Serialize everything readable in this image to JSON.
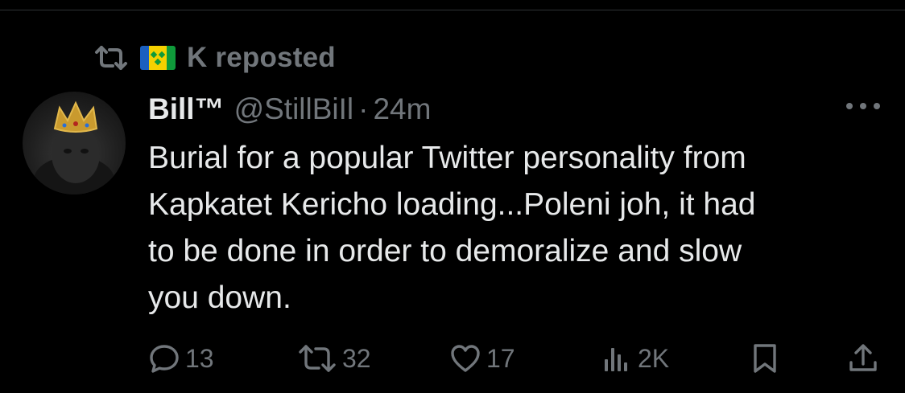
{
  "repost": {
    "text": "K reposted",
    "flag": "saint-vincent-and-the-grenadines-flag"
  },
  "tweet": {
    "author_name": "Bill™",
    "handle": "@StillBiIl",
    "separator": "·",
    "time": "24m",
    "text": "Burial for a popular Twitter personality from\nKapkatet Kericho loading...Poleni joh, it had\nto be done in order to demoralize and slow\nyou down."
  },
  "actions": {
    "replies": "13",
    "reposts": "32",
    "likes": "17",
    "views": "2K"
  },
  "icons": {
    "repost": "repost-icon",
    "more": "more-icon",
    "reply": "reply-icon",
    "like": "heart-icon",
    "views": "views-icon",
    "bookmark": "bookmark-icon",
    "share": "share-icon"
  },
  "colors": {
    "background": "#000000",
    "text_primary": "#e7e9ea",
    "text_secondary": "#71767b",
    "divider": "#2f3336"
  }
}
